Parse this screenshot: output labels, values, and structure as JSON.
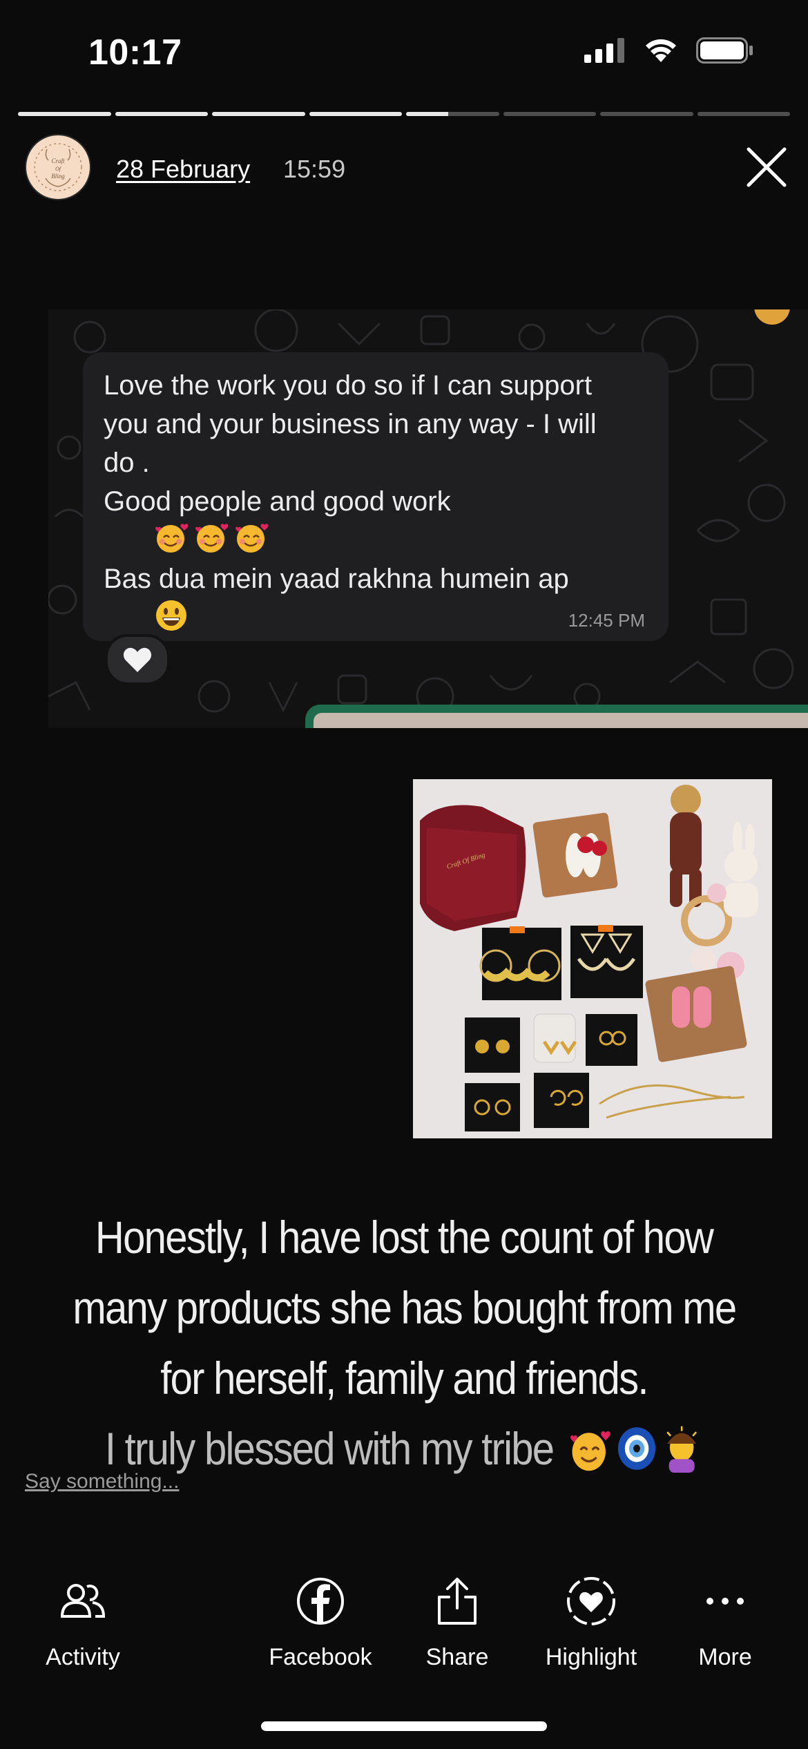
{
  "status_bar": {
    "time": "10:17",
    "icons": [
      "cellular-signal-icon",
      "wifi-icon",
      "battery-icon"
    ]
  },
  "story": {
    "segments_total": 8,
    "segments_viewed": 4,
    "current_segment_progress": 0.45,
    "date": "28 February",
    "time": "15:59",
    "avatar_text": "Craft Of Bling"
  },
  "chat_screenshot": {
    "message_lines": [
      "Love the work you do so if I can support",
      "you and your business in any way - I will",
      "do .",
      "Good people and good work",
      "",
      "Bas dua mein yaad rakhna humein ap"
    ],
    "message_time": "12:45 PM",
    "reaction": "white-heart"
  },
  "caption": {
    "lines": [
      "Honestly, I have lost the count of how",
      "many products she has bought from me",
      "for herself, family and friends.",
      "I truly blessed with my tribe"
    ]
  },
  "reply": {
    "label": "Say something..."
  },
  "actions": [
    {
      "id": "activity",
      "label": "Activity",
      "icon": "people-icon"
    },
    {
      "id": "facebook",
      "label": "Facebook",
      "icon": "facebook-icon"
    },
    {
      "id": "share",
      "label": "Share",
      "icon": "share-icon"
    },
    {
      "id": "highlight",
      "label": "Highlight",
      "icon": "highlight-heart-icon"
    },
    {
      "id": "more",
      "label": "More",
      "icon": "more-dots-icon"
    }
  ],
  "colors": {
    "background": "#0b0b0c",
    "bubble": "#1f1f21",
    "accent_green": "#1f6b4e"
  }
}
